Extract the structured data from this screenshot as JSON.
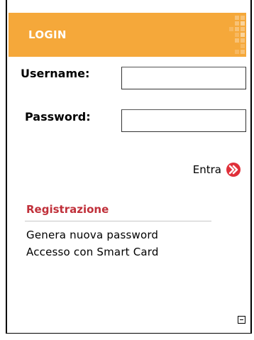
{
  "header": {
    "title": "LOGIN"
  },
  "form": {
    "username_label": "Username:",
    "username_value": "",
    "password_label": "Password:",
    "password_value": ""
  },
  "actions": {
    "enter_label": "Entra",
    "enter_icon": "arrow-right-circle-icon"
  },
  "registration": {
    "title": "Registrazione",
    "links": [
      "Genera nuova password",
      "Accesso con Smart Card"
    ]
  },
  "panel": {
    "collapse_icon": "minus-box-icon"
  },
  "colors": {
    "header_bg": "#f5a83a",
    "header_text": "#ffffff",
    "section_title": "#c0303a",
    "enter_icon": "#e0303a"
  }
}
